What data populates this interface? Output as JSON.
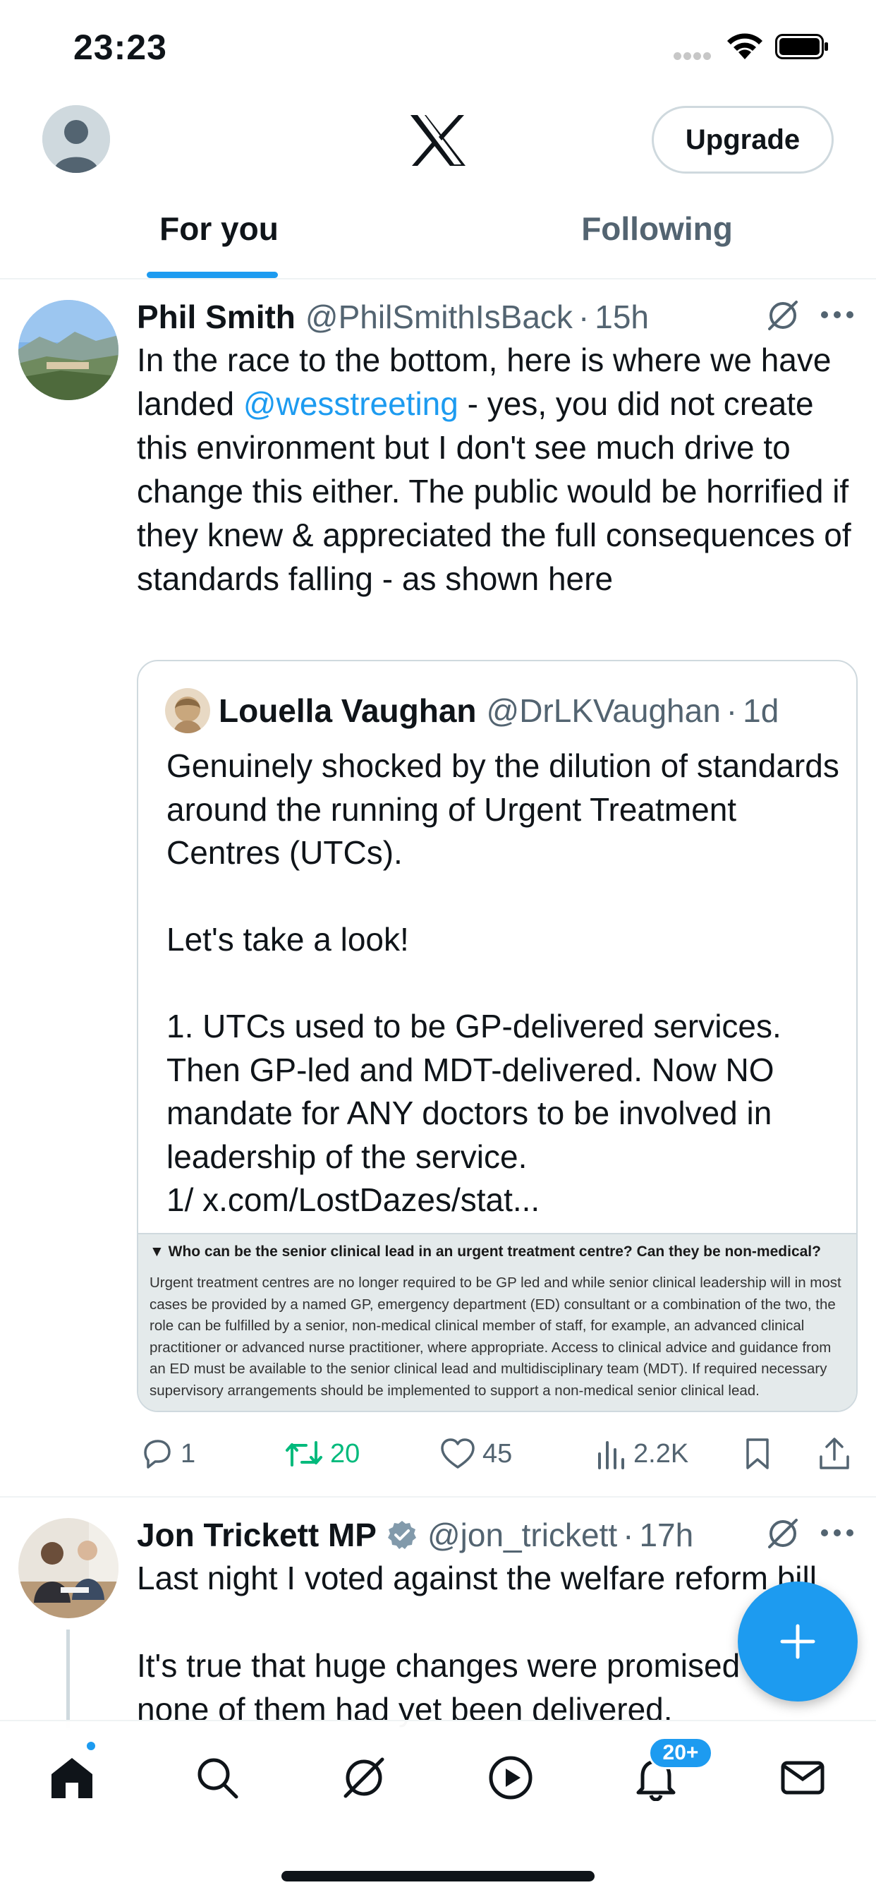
{
  "status_bar": {
    "time": "23:23"
  },
  "header": {
    "upgrade_label": "Upgrade",
    "tabs": [
      {
        "label": "For you"
      },
      {
        "label": "Following"
      }
    ]
  },
  "tweets": [
    {
      "name": "Phil Smith",
      "handle": "@PhilSmithIsBack",
      "separator": "·",
      "time": "15h",
      "text_before": "In the race to the bottom, here is where we have landed ",
      "mention": "@wesstreeting",
      "text_after": " - yes, you did not create this environment but I don't see much drive to change this either.  The public would be horrified if they knew & appreciated the full consequences of standards falling - as shown here",
      "quote": {
        "name": "Louella Vaughan",
        "handle": "@DrLKVaughan",
        "separator": "·",
        "time": "1d",
        "text": "Genuinely shocked by the dilution of standards around the running of Urgent Treatment Centres (UTCs).\n\nLet's take a look!\n\n1. UTCs used to be GP-delivered services. Then GP-led and MDT-delivered. Now NO mandate for ANY doctors to be involved in leadership of the service.\n1/ x.com/LostDazes/stat...",
        "media_title": "▼ Who can be the senior clinical lead in an urgent treatment centre? Can they be non-medical?",
        "media_body": "Urgent treatment centres are no longer required to be GP led and while senior clinical leadership will in most cases be provided by a named GP, emergency department (ED) consultant or a combination of the two, the role can be fulfilled by a senior, non-medical clinical member of staff, for example, an advanced clinical practitioner or advanced nurse practitioner, where appropriate. Access to clinical advice and guidance from an ED must be available to the senior clinical lead and multidisciplinary team (MDT). If required necessary supervisory arrangements should be implemented to support a non-medical senior clinical lead."
      },
      "stats": {
        "replies": "1",
        "retweets": "20",
        "likes": "45",
        "views": "2.2K"
      }
    },
    {
      "name": "Jon Trickett MP",
      "handle": "@jon_trickett",
      "separator": "·",
      "time": "17h",
      "text": "Last night I voted against the welfare reform bill\n\nIt's true that huge changes were promised but none of them had yet been delivered."
    }
  ],
  "nav": {
    "notification_badge": "20+"
  },
  "colors": {
    "accent": "#1d9bf0",
    "retweet_green": "#00ba7c",
    "secondary_text": "#536471",
    "verified": "#829aab"
  }
}
